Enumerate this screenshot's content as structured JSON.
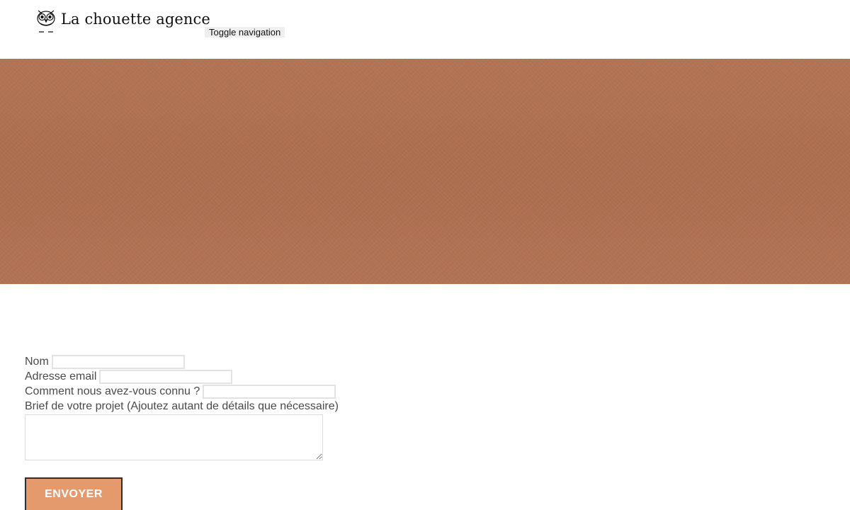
{
  "header": {
    "brand_name": "La chouette agence",
    "logo_icon": "owl-icon",
    "nav_toggle_label": "Toggle navigation"
  },
  "hero": {
    "background_color": "#b07252"
  },
  "contact_form": {
    "fields": [
      {
        "label": "Nom",
        "value": "",
        "placeholder": ""
      },
      {
        "label": "Adresse email",
        "value": "",
        "placeholder": ""
      },
      {
        "label": "Comment nous avez-vous connu ?",
        "value": "",
        "placeholder": ""
      }
    ],
    "brief_label": "Brief de votre projet (Ajoutez autant de détails que nécessaire)",
    "brief_value": "",
    "submit_label": "ENVOYER",
    "submit_color": "#e59a6d"
  }
}
